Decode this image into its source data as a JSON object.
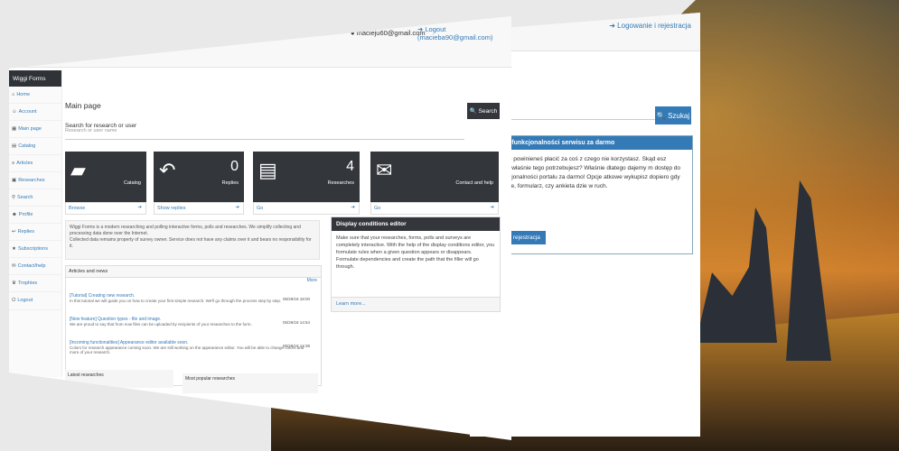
{
  "colors": {
    "accent": "#337ab7",
    "dark": "#33363b",
    "background": "#e9e9e9"
  },
  "back_panel": {
    "login_link": "Logowanie i rejestracja",
    "search_button": "Szukaj",
    "info_title": "ywaj pełnej funkcjonalności serwisu za darmo",
    "info_text": "zerwy. Je nie powinieneś płacić za coś z czego nie korzystasz. Skąd esz wiedzieć, że właśnie tego potrzebujesz? Właśnie dlatego dajemy m dostęp do całości funkcjonalności portalu za darmo! Opcje atkowe wykupisz dopiero gdy twoje badanie, formularz, czy ankieta dzie w ruch.",
    "info_button": "ogowanie i rejestracja"
  },
  "header": {
    "user_email": "macieju60@gmail.com",
    "logout": "Logout (macieba90@gmail.com)"
  },
  "sidebar": {
    "brand": "Wiggi Forms",
    "items": [
      {
        "icon": "home-icon",
        "label": "Home"
      },
      {
        "icon": "account-icon",
        "label": "Account"
      },
      {
        "icon": "main-page-icon",
        "label": "Main page"
      },
      {
        "icon": "catalog-icon",
        "label": "Catalog"
      },
      {
        "icon": "articles-icon",
        "label": "Articles"
      },
      {
        "icon": "researches-icon",
        "label": "Researches"
      },
      {
        "icon": "search-icon",
        "label": "Search"
      },
      {
        "icon": "profile-icon",
        "label": "Profile"
      },
      {
        "icon": "replies-icon",
        "label": "Replies"
      },
      {
        "icon": "subscription-icon",
        "label": "Subscriptions"
      },
      {
        "icon": "contact-icon",
        "label": "Contact/help"
      },
      {
        "icon": "trophy-icon",
        "label": "Trophies"
      },
      {
        "icon": "logout-icon",
        "label": "Logout"
      }
    ]
  },
  "main": {
    "title": "Main page",
    "search_label": "Search for research or user",
    "search_placeholder": "Research or user name",
    "search_button": "Search"
  },
  "tiles": [
    {
      "icon": "folder-icon",
      "count": "",
      "label": "Catalog",
      "link": "Browse"
    },
    {
      "icon": "reply-icon",
      "count": "0",
      "label": "Replies",
      "link": "Show replies"
    },
    {
      "icon": "document-icon",
      "count": "4",
      "label": "Researches",
      "link": "Go"
    },
    {
      "icon": "envelope-icon",
      "count": "",
      "label": "Contact and help",
      "link": "Go"
    }
  ],
  "intro": {
    "line1": "Wiggi Forms is a modern researching and polling interactive forms, polls and researches. We simplify collecting and processing data done over the Internet.",
    "line2": "Collected data remains property of survey owner. Service does not have any claims over it and bears no responsibility for it."
  },
  "articles": {
    "title": "Articles and news",
    "more": "More",
    "items": [
      {
        "title": "[Tutorial] Creating new research.",
        "desc": "In this tutorial we will guide you on how to create your first simple research. We'll go through the process step by step.",
        "date": "05/29/18 18:00"
      },
      {
        "title": "[New feature] Question types - file and image.",
        "desc": "We are proud to say that from now files can be uploaded by recipients of your researches to the form.",
        "date": "05/29/18 14:54"
      },
      {
        "title": "[Incoming functionalities] Appearance editor available soon.",
        "desc": "Colors for research appearance coming soon. We are still working on the appearance editor. You will be able to change colors and more of your research.",
        "date": "05/29/18 14:38"
      }
    ]
  },
  "latest": {
    "title": "Latest researches"
  },
  "popular": {
    "title": "Most popular researches"
  },
  "editor": {
    "title": "Display conditions editor",
    "body": "Make sure that your researches, forms, polls and surveys are completely interactive. With the help of the display conditions editor, you formulate rules when a given question appears or disappears. Formulate dependencies and create the path that the filler will go through.",
    "link": "Learn more..."
  }
}
